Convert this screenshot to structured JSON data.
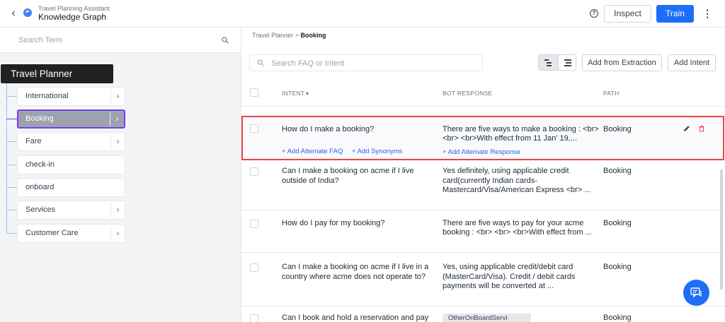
{
  "header": {
    "app_subtitle": "Travel Planning Assistant",
    "app_title": "Knowledge Graph",
    "help_glyph": "?",
    "inspect_label": "Inspect",
    "train_label": "Train"
  },
  "left": {
    "search_placeholder": "Search Term",
    "root": "Travel Planner",
    "nodes": [
      {
        "label": "International",
        "has_children": true
      },
      {
        "label": "Booking",
        "has_children": true,
        "selected": true
      },
      {
        "label": "Fare",
        "has_children": true
      },
      {
        "label": "check-in",
        "has_children": false
      },
      {
        "label": "onboard",
        "has_children": false
      },
      {
        "label": "Services",
        "has_children": true
      },
      {
        "label": "Customer Care",
        "has_children": true
      }
    ]
  },
  "breadcrumb": {
    "parent": "Travel Planner",
    "separator": ">",
    "current": "Booking"
  },
  "toolbar": {
    "search_placeholder": "Search FAQ or Intent",
    "add_extraction_label": "Add from Extraction",
    "add_intent_label": "Add Intent"
  },
  "table": {
    "columns": {
      "intent": "INTENT",
      "bot_response": "BOT RESPONSE",
      "path": "PATH"
    },
    "rows": [
      {
        "intent": "How do I make a booking?",
        "response_1": "There are five ways to make a booking : <br>",
        "response_2": "<br> <br>With effect from 11 Jan' 19,...",
        "path": "Booking",
        "add_alt_faq": "+ Add Alternate FAQ",
        "add_synonyms": "+ Add Synonyms",
        "add_alt_response": "+ Add Alternate Response"
      },
      {
        "intent_1": "Can I make a booking on acme if I live",
        "intent_2": "outside of India?",
        "response_1": "Yes definitely, using applicable credit",
        "response_2": "card(currently Indian cards-",
        "response_3": "Mastercard/Visa/American Express <br> ...",
        "path": "Booking"
      },
      {
        "intent": "How do I pay for my booking?",
        "response_1": "There are five ways to pay for your acme",
        "response_2": "booking : <br> <br> <br>With effect from ...",
        "path": "Booking"
      },
      {
        "intent_1": "Can I make a booking on acme if I live in a",
        "intent_2": "country where acme does not operate to?",
        "response_1": "Yes, using applicable credit/debit card",
        "response_2": "(MasterCard/Visa). Credit / debit cards",
        "response_3": "payments will be converted at ...",
        "path": "Booking"
      },
      {
        "intent": "Can I book and hold a reservation and pay",
        "tag": "OtherOnBoardServi",
        "path": "Booking"
      }
    ]
  },
  "colors": {
    "primary": "#1d6ef5",
    "highlight_border": "#ef4444",
    "selected_node_border": "#7c3aed"
  }
}
